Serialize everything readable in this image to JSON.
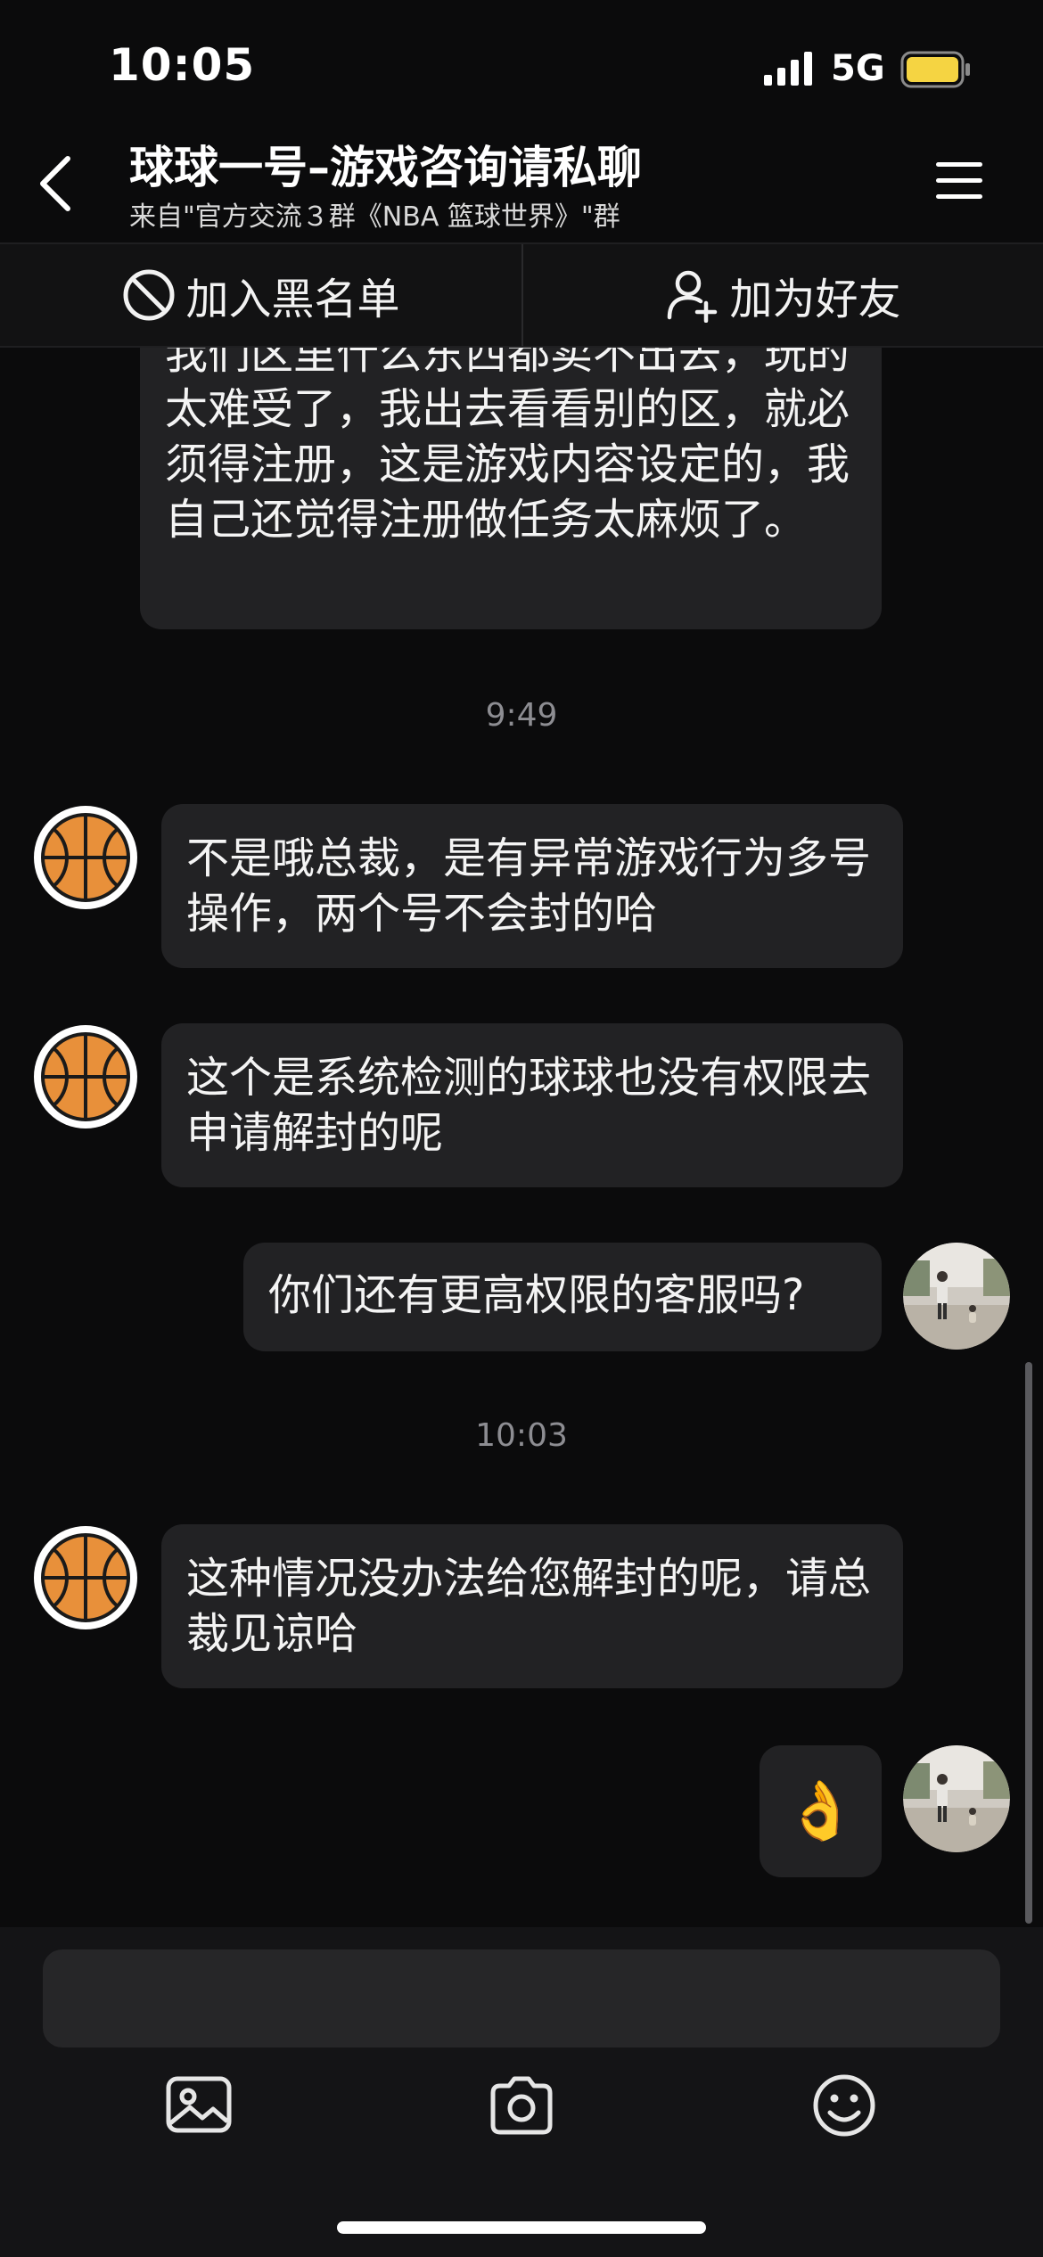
{
  "status": {
    "time": "10:05",
    "network": "5G"
  },
  "header": {
    "title": "球球一号–游戏咨询请私聊",
    "subtitle": "来自\"官方交流３群《NBA 篮球世界》\"群"
  },
  "actions": {
    "block_label": "加入黑名单",
    "add_friend_label": "加为好友"
  },
  "messages": [
    {
      "side": "left-cut",
      "text": "我们区里什么东西都卖不出去，玩的太难受了，我出去看看别的区，就必须得注册，这是游戏内容设定的，我自己还觉得注册做任务太麻烦了。"
    },
    {
      "type": "time",
      "text": "9:49"
    },
    {
      "side": "left",
      "text": "不是哦总裁，是有异常游戏行为多号操作，两个号不会封的哈"
    },
    {
      "side": "left",
      "text": "这个是系统检测的球球也没有权限去申请解封的呢"
    },
    {
      "side": "right",
      "text": "你们还有更高权限的客服吗?"
    },
    {
      "type": "time",
      "text": "10:03"
    },
    {
      "side": "left",
      "text": "这种情况没办法给您解封的呢，请总裁见谅哈"
    },
    {
      "side": "right",
      "text": "👌"
    }
  ],
  "colors": {
    "accent_battery": "#f5d442",
    "bubble": "#222224",
    "background": "#0b0b0c",
    "ball": "#e8903a"
  },
  "toolbar": {
    "icons": [
      "image-icon",
      "camera-icon",
      "emoji-icon"
    ]
  }
}
